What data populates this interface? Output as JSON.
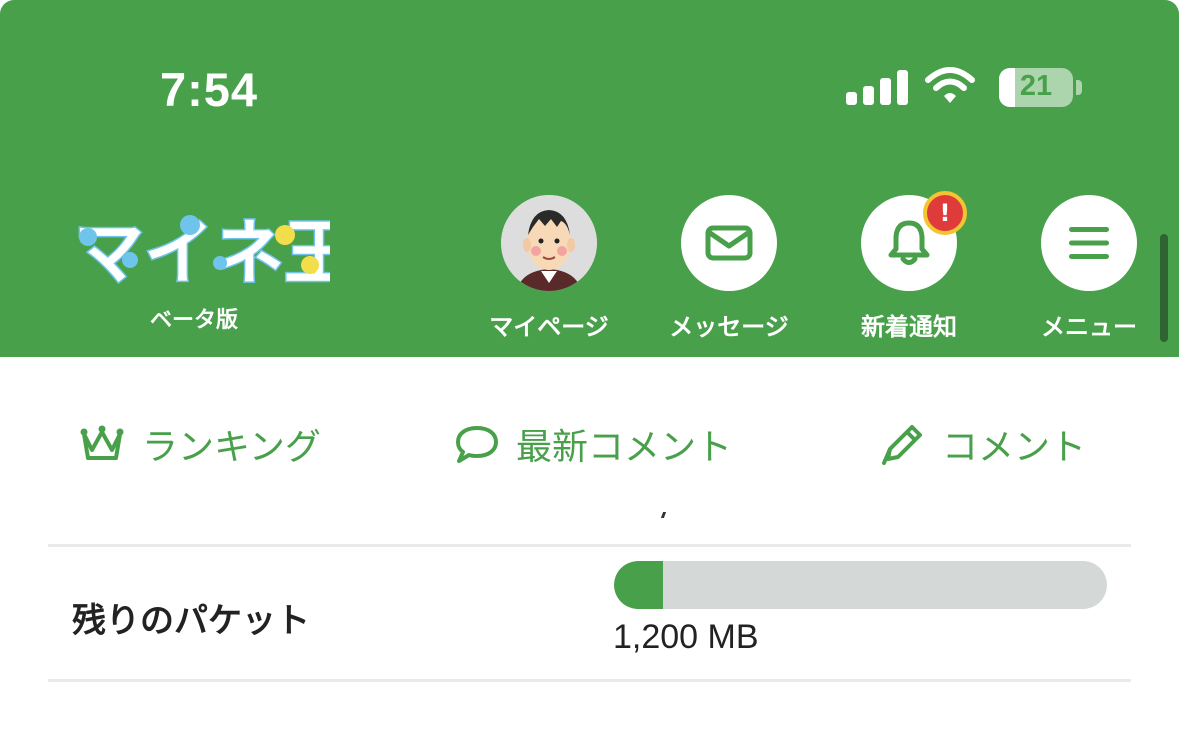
{
  "status_bar": {
    "time": "7:54",
    "battery": "21"
  },
  "logo": {
    "title": "マイネ王",
    "subtitle": "ベータ版"
  },
  "nav": {
    "mypage": "マイページ",
    "messages": "メッセージ",
    "notifications": "新着通知",
    "menu": "メニュー",
    "notification_badge": "!"
  },
  "tabs": {
    "ranking": "ランキング",
    "latest_comments": "最新コメント",
    "comment": "コメント"
  },
  "separator_mark": ",",
  "packet": {
    "label": "残りのパケット",
    "value": "1,200 MB",
    "fill_fraction": 0.1
  },
  "colors": {
    "brand_green": "#48a04a",
    "badge_red": "#e03b3b",
    "badge_ring": "#f4c431",
    "track_gray": "#d4d9d7"
  }
}
